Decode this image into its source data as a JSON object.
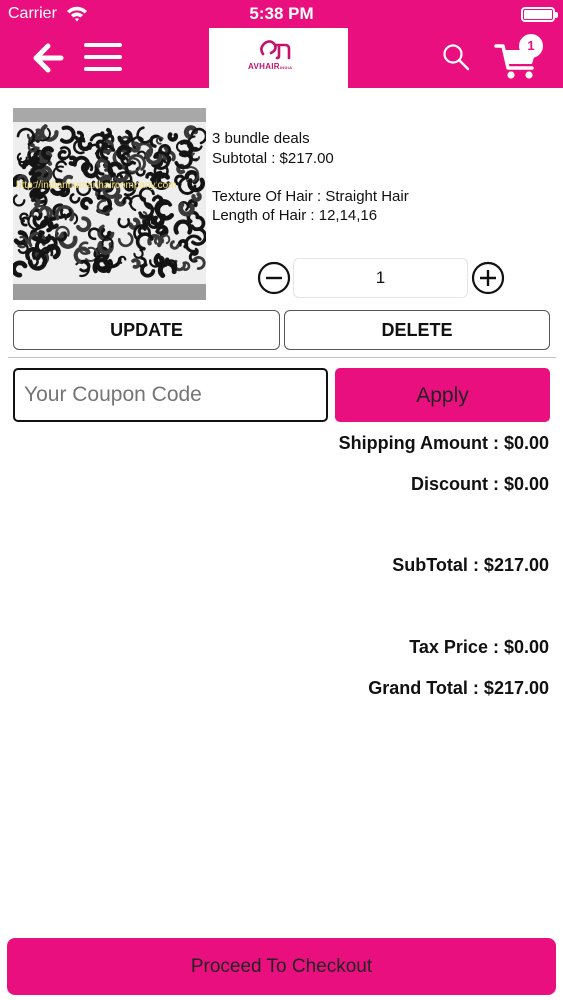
{
  "status_bar": {
    "carrier": "Carrier",
    "time": "5:38 PM"
  },
  "header": {
    "logo_text": "AVHAIR",
    "logo_sub": "INDIA",
    "cart_count": "1",
    "accent_color": "#ea0f7e"
  },
  "product": {
    "image_watermark": "http://indianhumanhaircompany.com",
    "name": "3 bundle deals",
    "subtotal": "Subtotal : $217.00",
    "texture": "Texture Of Hair : Straight Hair",
    "length": "Length of Hair : 12,14,16",
    "quantity": "1"
  },
  "actions": {
    "update": "UPDATE",
    "delete": "DELETE"
  },
  "coupon": {
    "placeholder": "Your Coupon Code",
    "apply": "Apply"
  },
  "summary": {
    "shipping": "Shipping Amount : $0.00",
    "discount": "Discount : $0.00",
    "subtotal": "SubTotal : $217.00",
    "tax": "Tax Price : $0.00",
    "grand_total": "Grand Total : $217.00"
  },
  "checkout": {
    "label": "Proceed To Checkout"
  }
}
